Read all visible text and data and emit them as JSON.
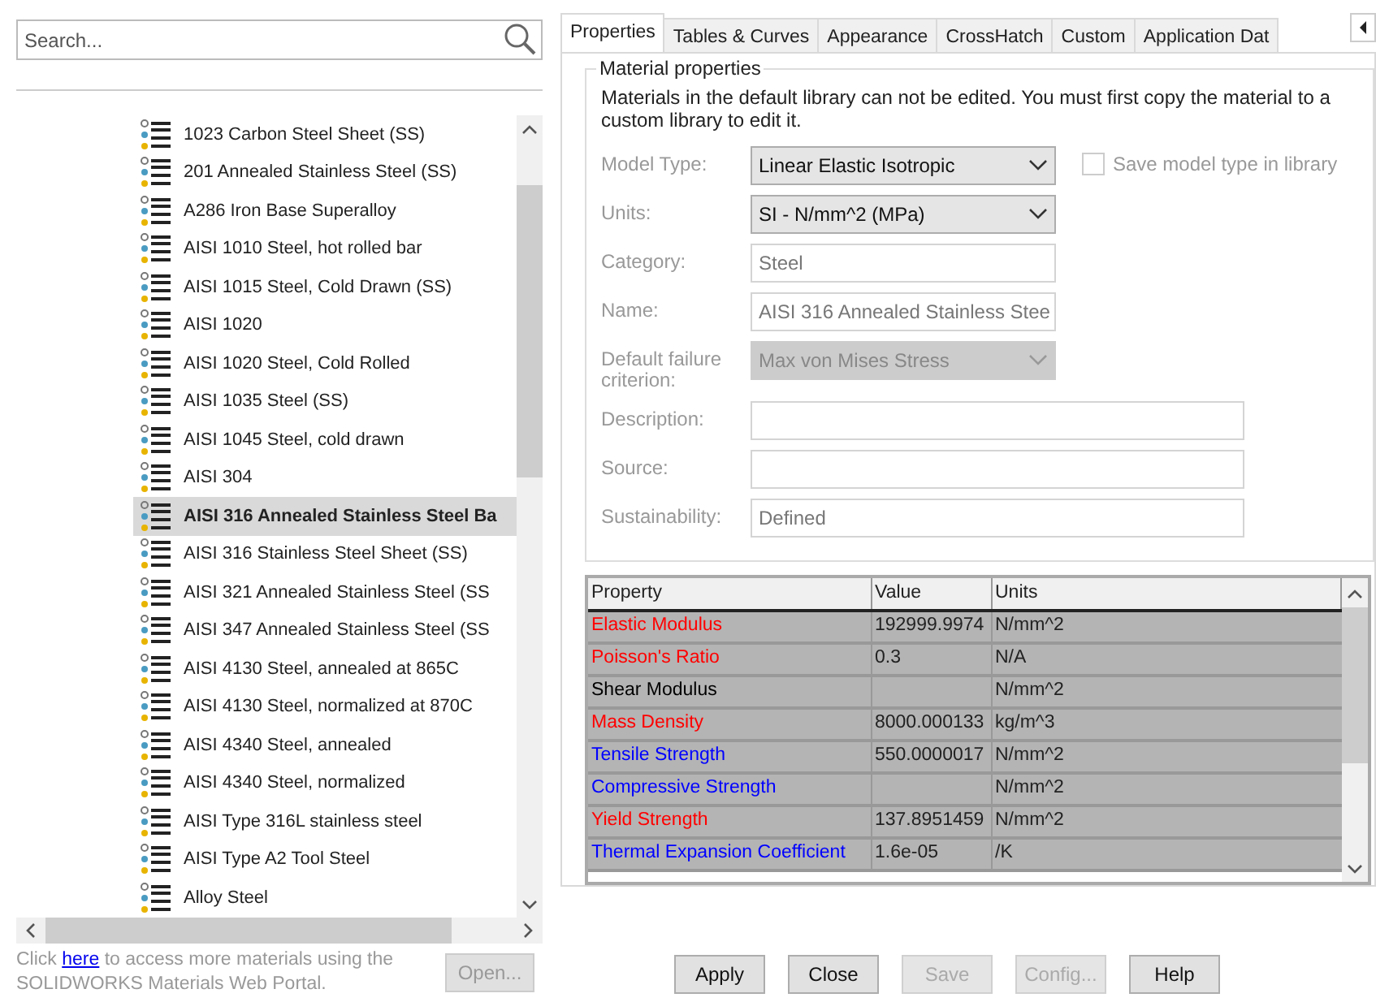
{
  "search": {
    "placeholder": "Search..."
  },
  "materials": [
    {
      "label": "1023 Carbon Steel Sheet (SS)",
      "selected": false
    },
    {
      "label": "201 Annealed Stainless Steel (SS)",
      "selected": false
    },
    {
      "label": "A286 Iron Base Superalloy",
      "selected": false
    },
    {
      "label": "AISI 1010 Steel, hot rolled bar",
      "selected": false
    },
    {
      "label": "AISI 1015 Steel, Cold Drawn (SS)",
      "selected": false
    },
    {
      "label": "AISI 1020",
      "selected": false
    },
    {
      "label": "AISI 1020 Steel, Cold Rolled",
      "selected": false
    },
    {
      "label": "AISI 1035 Steel (SS)",
      "selected": false
    },
    {
      "label": "AISI 1045 Steel, cold drawn",
      "selected": false
    },
    {
      "label": "AISI 304",
      "selected": false
    },
    {
      "label": "AISI 316 Annealed Stainless Steel Ba",
      "selected": true
    },
    {
      "label": "AISI 316 Stainless Steel Sheet (SS)",
      "selected": false
    },
    {
      "label": "AISI 321 Annealed Stainless Steel (SS",
      "selected": false
    },
    {
      "label": "AISI 347 Annealed Stainless Steel (SS",
      "selected": false
    },
    {
      "label": "AISI 4130 Steel, annealed at 865C",
      "selected": false
    },
    {
      "label": "AISI 4130 Steel, normalized at 870C",
      "selected": false
    },
    {
      "label": "AISI 4340 Steel, annealed",
      "selected": false
    },
    {
      "label": "AISI 4340 Steel, normalized",
      "selected": false
    },
    {
      "label": "AISI Type 316L stainless steel",
      "selected": false
    },
    {
      "label": "AISI Type A2 Tool Steel",
      "selected": false
    },
    {
      "label": "Alloy Steel",
      "selected": false
    }
  ],
  "footer": {
    "before": "Click",
    "link": "here",
    "after": "to access more materials using the SOLIDWORKS Materials Web Portal."
  },
  "open_button": {
    "label": "Open...",
    "disabled": true
  },
  "tabs": [
    {
      "label": "Properties",
      "selected": true
    },
    {
      "label": "Tables & Curves",
      "selected": false
    },
    {
      "label": "Appearance",
      "selected": false
    },
    {
      "label": "CrossHatch",
      "selected": false
    },
    {
      "label": "Custom",
      "selected": false
    },
    {
      "label": "Application Dat",
      "selected": false
    }
  ],
  "group": {
    "title": "Material properties",
    "note": "Materials in the default library can not be edited. You must first copy the material to a custom library to edit it."
  },
  "fields": [
    {
      "label": "Model Type:",
      "kind": "select",
      "value": "Linear Elastic Isotropic",
      "disabled": false
    },
    {
      "label": "Units:",
      "kind": "select",
      "value": "SI - N/mm^2 (MPa)",
      "disabled": false
    },
    {
      "label": "Category:",
      "kind": "text",
      "value": "Steel",
      "disabled": true
    },
    {
      "label": "Name:",
      "kind": "text",
      "value": "AISI 316 Annealed Stainless Stee",
      "disabled": true
    },
    {
      "label": "Default failure criterion:",
      "kind": "select",
      "value": "Max von Mises Stress",
      "disabled": true
    },
    {
      "label": "Description:",
      "kind": "wide",
      "disabled": true
    },
    {
      "label": "Source:",
      "kind": "wide",
      "disabled": true
    },
    {
      "label": "Sustainability:",
      "kind": "wide",
      "value": "Defined",
      "disabled": true
    }
  ],
  "save_model_type": {
    "label": "Save model type in library",
    "checked": false,
    "disabled": true
  },
  "table": {
    "columns": [
      "Property",
      "Value",
      "Units"
    ],
    "rows": [
      {
        "property": "Elastic Modulus",
        "value": "192999.9974",
        "units": "N/mm^2",
        "color": "#ff0000"
      },
      {
        "property": "Poisson's Ratio",
        "value": "0.3",
        "units": "N/A",
        "color": "#ff0000"
      },
      {
        "property": "Shear Modulus",
        "units": "N/mm^2",
        "color": "#000000"
      },
      {
        "property": "Mass Density",
        "value": "8000.000133",
        "units": "kg/m^3",
        "color": "#ff0000"
      },
      {
        "property": "Tensile Strength",
        "value": "550.0000017",
        "units": "N/mm^2",
        "color": "#0000ff"
      },
      {
        "property": "Compressive Strength",
        "units": "N/mm^2",
        "color": "#0000ff"
      },
      {
        "property": "Yield Strength",
        "value": "137.8951459",
        "units": "N/mm^2",
        "color": "#ff0000"
      },
      {
        "property": "Thermal Expansion Coefficient",
        "value": "1.6e-05",
        "units": "/K",
        "color": "#0000ff"
      }
    ]
  },
  "buttons": [
    {
      "label": "Apply",
      "disabled": false
    },
    {
      "label": "Close",
      "disabled": false
    },
    {
      "label": "Save",
      "disabled": true
    },
    {
      "label": "Config...",
      "disabled": true
    },
    {
      "label": "Help",
      "disabled": false
    }
  ]
}
